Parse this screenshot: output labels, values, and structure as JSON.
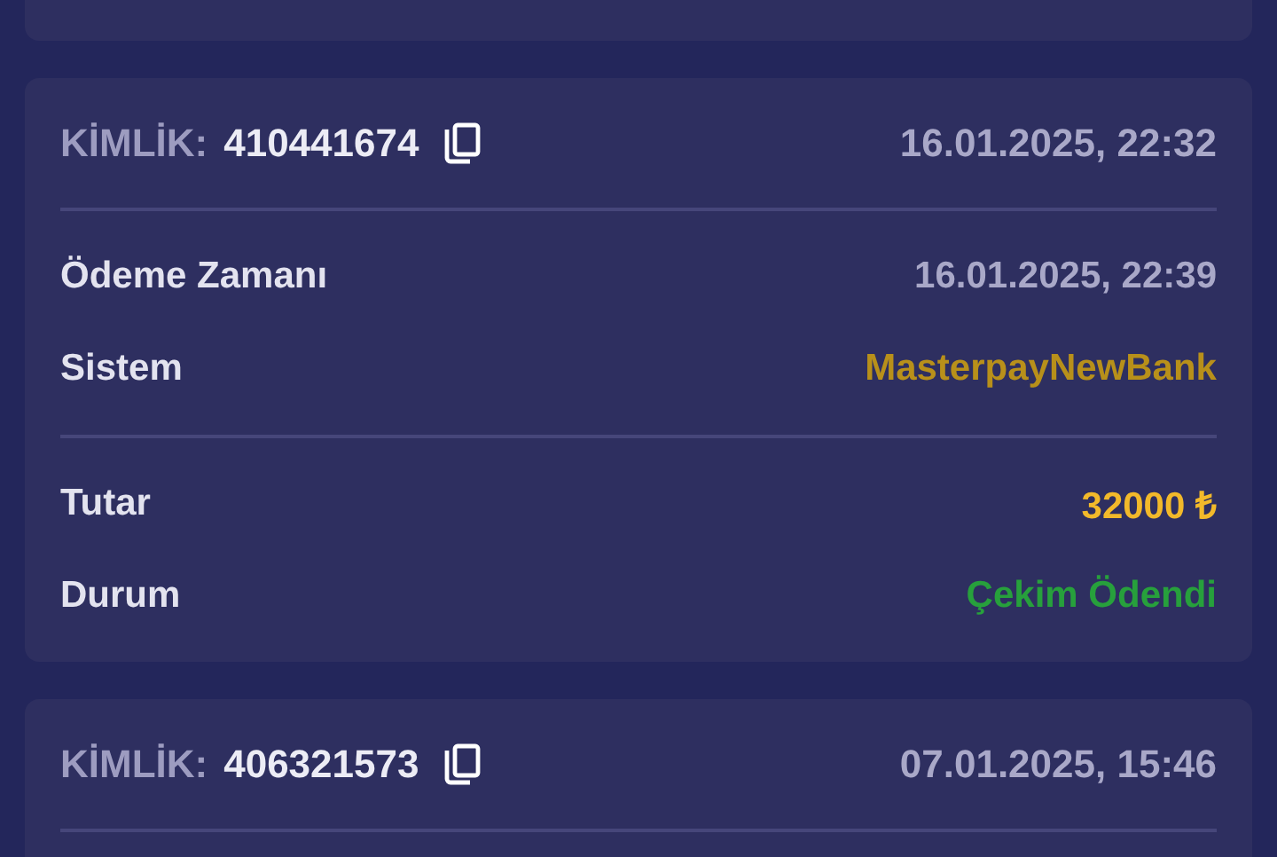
{
  "transactions": [
    {
      "id_label": "KİMLİK:",
      "id": "410441674",
      "created": "16.01.2025, 22:32",
      "sections": [
        [
          {
            "label": "Ödeme Zamanı",
            "value": "16.01.2025, 22:39",
            "kind": "time"
          },
          {
            "label": "Sistem",
            "value": "MasterpayNewBank",
            "kind": "system"
          }
        ],
        [
          {
            "label": "Tutar",
            "value": "32000 ₺",
            "kind": "amount"
          },
          {
            "label": "Durum",
            "value": "Çekim Ödendi",
            "kind": "status"
          }
        ]
      ]
    },
    {
      "id_label": "KİMLİK:",
      "id": "406321573",
      "created": "07.01.2025, 15:46"
    }
  ]
}
